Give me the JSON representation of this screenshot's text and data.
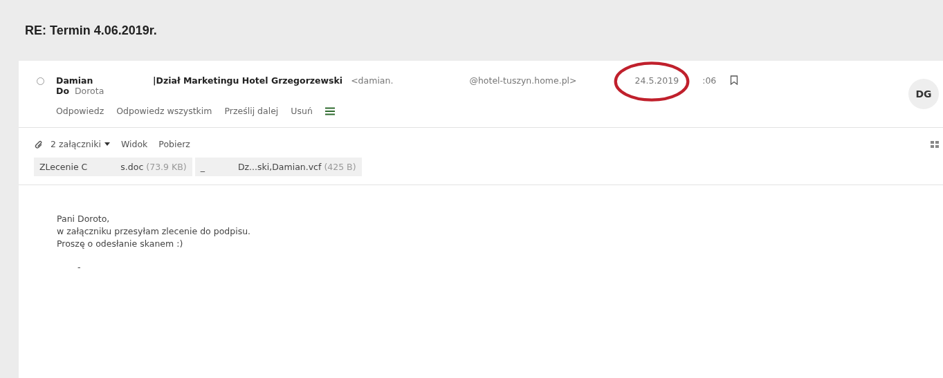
{
  "subject": "RE: Termin 4.06.2019r.",
  "message": {
    "selected": false,
    "sender_name": "Damian",
    "sender_org": "|Dział Marketingu Hotel Grzegorzewski",
    "sender_email_start": "<damian.",
    "sender_email_end": "@hotel-tuszyn.home.pl>",
    "to_label": "Do",
    "to_name": "Dorota",
    "date": "24.5.2019",
    "time": ":06",
    "avatar": "DG",
    "date_circled": true
  },
  "actions": [
    "Odpowiedz",
    "Odpowiedz wszystkim",
    "Prześlij dalej",
    "Usuń"
  ],
  "attachments": {
    "count_label": "2 załączniki",
    "view": "Widok",
    "download": "Pobierz",
    "files": [
      {
        "parts": [
          "ZLecenie C",
          "s.doc"
        ],
        "size": "(73.9 KB)"
      },
      {
        "parts": [
          "_",
          "Dz...ski,Damian.vcf"
        ],
        "size": "(425 B)"
      }
    ]
  },
  "body": [
    "Pani Doroto,",
    "w załączniku przesyłam zlecenie do podpisu.",
    "Proszę o odesłanie skanem :)",
    "-"
  ]
}
